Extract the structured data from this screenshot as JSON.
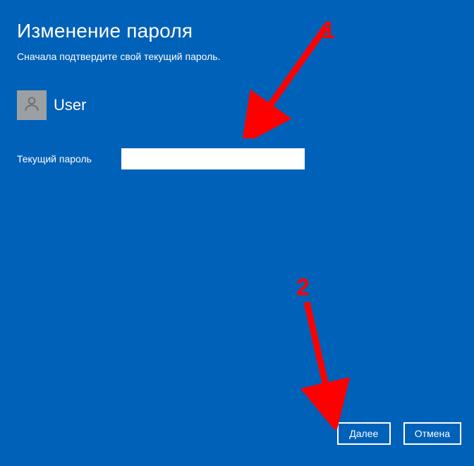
{
  "title": "Изменение пароля",
  "subtitle": "Сначала подтвердите свой текущий пароль.",
  "user": {
    "name": "User"
  },
  "field": {
    "label": "Текущий пароль",
    "value": ""
  },
  "buttons": {
    "next": "Далее",
    "cancel": "Отмена"
  },
  "annotations": {
    "marker1": "1",
    "marker2": "2"
  }
}
